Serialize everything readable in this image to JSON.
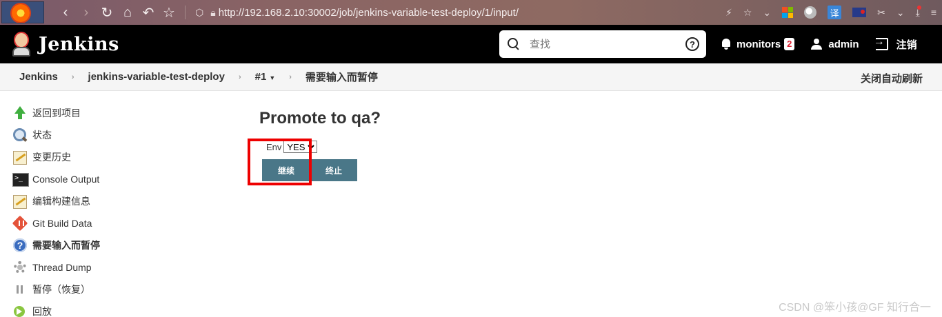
{
  "browser": {
    "url": "http://192.168.2.10:30002/job/jenkins-variable-test-deploy/1/input/"
  },
  "header": {
    "brand": "Jenkins",
    "search_placeholder": "查找",
    "monitors_label": "monitors",
    "monitors_count": "2",
    "user": "admin",
    "logout_label": "注销"
  },
  "breadcrumb": {
    "items": [
      "Jenkins",
      "jenkins-variable-test-deploy",
      "#1",
      "需要输入而暂停"
    ],
    "auto_refresh": "关闭自动刷新"
  },
  "sidebar": {
    "items": [
      {
        "label": "返回到项目",
        "icon": "up-arrow-icon"
      },
      {
        "label": "状态",
        "icon": "search-icon"
      },
      {
        "label": "变更历史",
        "icon": "notepad-icon"
      },
      {
        "label": "Console Output",
        "icon": "terminal-icon"
      },
      {
        "label": "编辑构建信息",
        "icon": "notepad-icon"
      },
      {
        "label": "Git Build Data",
        "icon": "git-icon"
      },
      {
        "label": "需要输入而暂停",
        "icon": "help-icon"
      },
      {
        "label": "Thread Dump",
        "icon": "gear-icon"
      },
      {
        "label": "暂停（恢复）",
        "icon": "pause-icon"
      },
      {
        "label": "回放",
        "icon": "replay-icon"
      }
    ]
  },
  "main": {
    "title": "Promote to qa?",
    "param_label": "Env",
    "param_value": "YES",
    "continue_label": "继续",
    "abort_label": "终止"
  },
  "watermark": "CSDN @笨小孩@GF 知行合一"
}
